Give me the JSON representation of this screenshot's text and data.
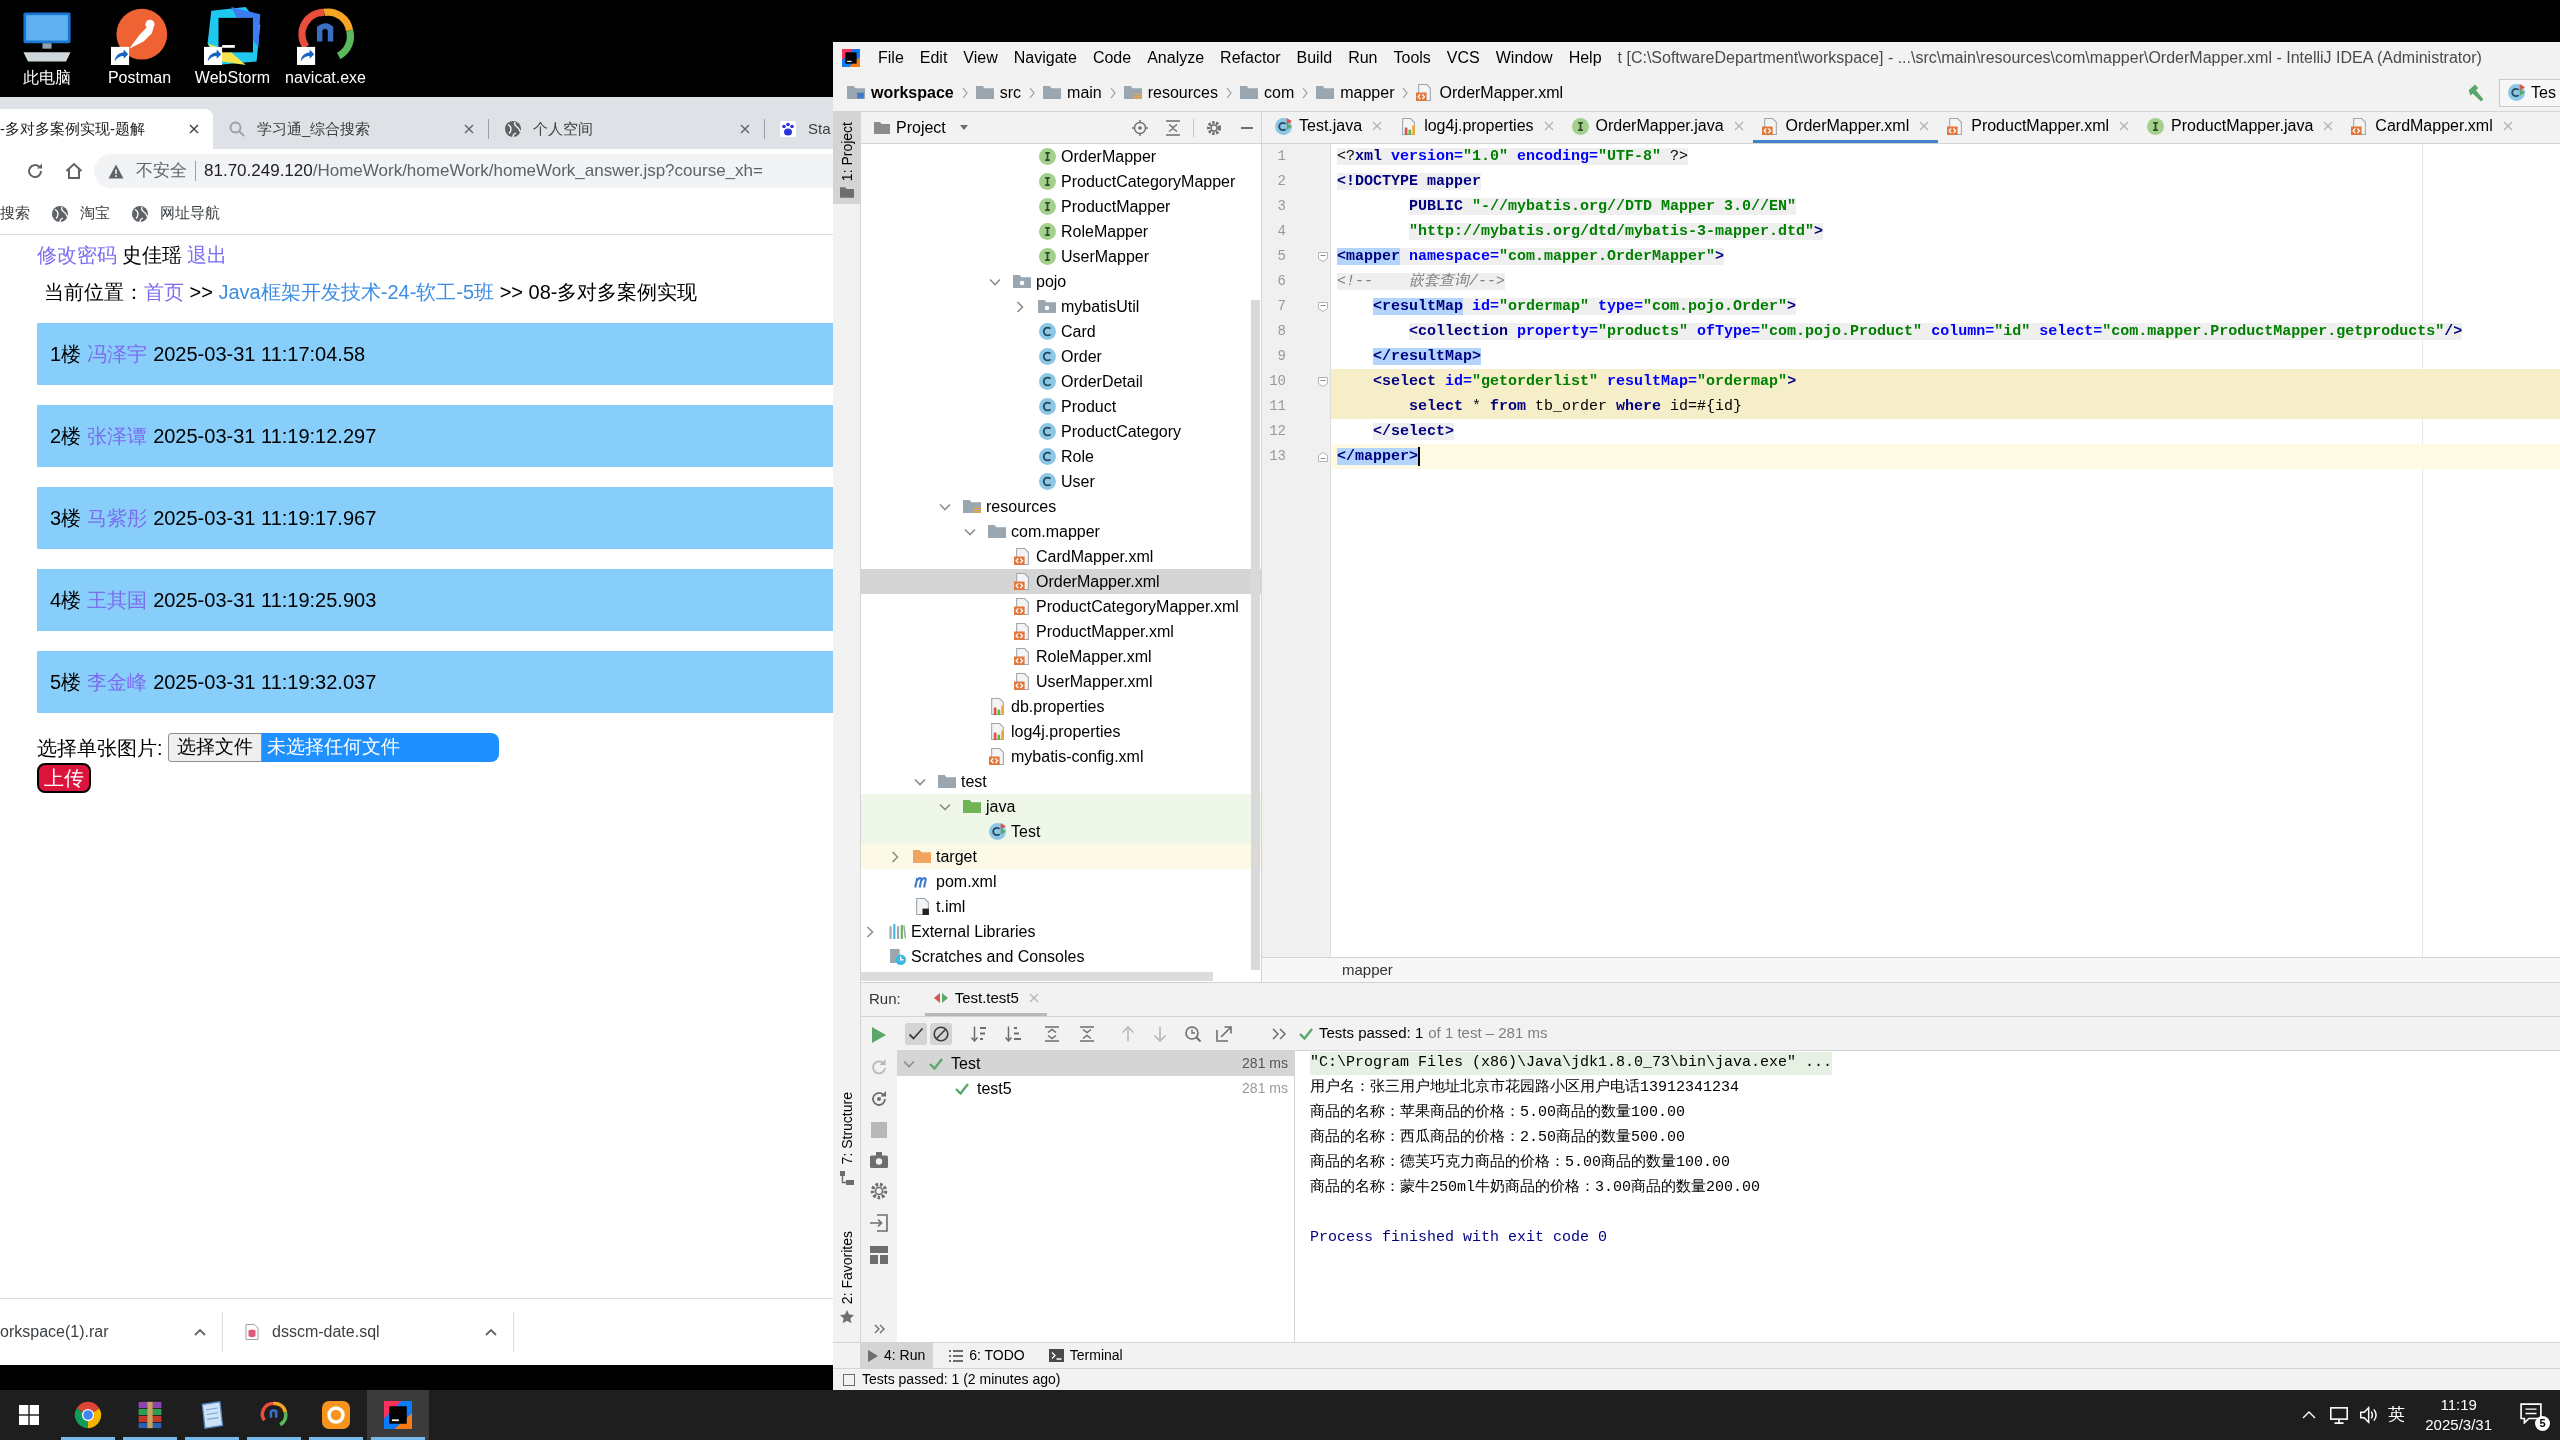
{
  "desktop": {
    "icons": [
      {
        "label": "此电脑",
        "kind": "computer",
        "shortcut": false
      },
      {
        "label": "Postman",
        "kind": "postman",
        "shortcut": true
      },
      {
        "label": "WebStorm",
        "kind": "webstorm",
        "shortcut": true
      },
      {
        "label": "navicat.exe",
        "kind": "navicat",
        "shortcut": true
      }
    ]
  },
  "browser": {
    "tabs": [
      {
        "title": "-多对多案例实现-题解",
        "selected": true
      },
      {
        "title": "学习通_综合搜索",
        "kind": "search",
        "selected": false
      },
      {
        "title": "个人空间",
        "kind": "globe",
        "selected": false
      },
      {
        "title": "Sta",
        "kind": "paw",
        "selected": false
      }
    ],
    "address": {
      "security": "不安全",
      "host": "81.70.249.120",
      "path": "/HomeWork/homeWork/homeWork_answer.jsp?course_xh="
    },
    "bookmarks": [
      {
        "label": "搜索"
      },
      {
        "label": "淘宝",
        "kind": "globe"
      },
      {
        "label": "网址导航",
        "kind": "globe"
      }
    ],
    "page": {
      "user_bar": [
        {
          "text": "修改密码",
          "kind": "visited"
        },
        {
          "text": "史佳瑶",
          "kind": "text"
        },
        {
          "text": "退出",
          "kind": "visited"
        }
      ],
      "location": [
        {
          "text": "当前位置：",
          "kind": "text"
        },
        {
          "text": "首页",
          "kind": "visited"
        },
        {
          "text": ">>",
          "kind": "text"
        },
        {
          "text": "Java框架开发技术-24-软工-5班",
          "kind": "link"
        },
        {
          "text": ">>",
          "kind": "text"
        },
        {
          "text": "08-多对多案例实现",
          "kind": "text"
        }
      ],
      "replies": [
        {
          "floor": "1楼",
          "author": "冯泽宇",
          "time": "2025-03-31 11:17:04.58"
        },
        {
          "floor": "2楼",
          "author": "张泽谭",
          "time": "2025-03-31 11:19:12.297"
        },
        {
          "floor": "3楼",
          "author": "马紫彤",
          "time": "2025-03-31 11:19:17.967"
        },
        {
          "floor": "4楼",
          "author": "王其国",
          "time": "2025-03-31 11:19:25.903"
        },
        {
          "floor": "5楼",
          "author": "李金峰",
          "time": "2025-03-31 11:19:32.037"
        }
      ],
      "upload": {
        "label": "选择单张图片:",
        "button": "选择文件",
        "status": "未选择任何文件",
        "submit": "上传"
      }
    },
    "downloads": [
      {
        "name": "orkspace(1).rar"
      },
      {
        "name": "dsscm-date.sql",
        "kind": "sql"
      }
    ]
  },
  "ide": {
    "menu": [
      "File",
      "Edit",
      "View",
      "Navigate",
      "Code",
      "Analyze",
      "Refactor",
      "Build",
      "Run",
      "Tools",
      "VCS",
      "Window",
      "Help"
    ],
    "title": "t [C:\\SoftwareDepartment\\workspace] - ...\\src\\main\\resources\\com\\mapper\\OrderMapper.xml - IntelliJ IDEA (Administrator)",
    "nav": [
      {
        "label": "workspace",
        "kind": "module"
      },
      {
        "label": "src",
        "kind": "folder"
      },
      {
        "label": "main",
        "kind": "folder"
      },
      {
        "label": "resources",
        "kind": "resources"
      },
      {
        "label": "com",
        "kind": "folder"
      },
      {
        "label": "mapper",
        "kind": "folder"
      },
      {
        "label": "OrderMapper.xml",
        "kind": "xml"
      }
    ],
    "run_config": "Tes",
    "stripe": {
      "top": [
        {
          "label": "1: Project",
          "kind": "folder",
          "selected": true
        }
      ],
      "bottom": [
        {
          "label": "7: Structure",
          "kind": "structure",
          "selected": false
        },
        {
          "label": "2: Favorites",
          "kind": "star",
          "selected": false
        }
      ]
    },
    "project": {
      "title": "Project",
      "tree": [
        {
          "children": [
            {
              "children": [
                {
                  "children": [
                    {
                      "children": [
                        {
                          "children": [
                            {
                              "children": [
                                {
                                  "label": "OrderMapper",
                                  "kind": "interface",
                                  "selected": false
                                },
                                {
                                  "label": "ProductCategoryMapper",
                                  "kind": "interface",
                                  "selected": false
                                },
                                {
                                  "label": "ProductMapper",
                                  "kind": "interface",
                                  "selected": false
                                },
                                {
                                  "label": "RoleMapper",
                                  "kind": "interface",
                                  "selected": false
                                },
                                {
                                  "label": "UserMapper",
                                  "kind": "interface",
                                  "selected": false
                                }
                              ]
                            },
                            {
                              "label": "pojo",
                              "kind": "package",
                              "expanded": true,
                              "selected": false,
                              "children": [
                                {
                                  "label": "mybatisUtil",
                                  "kind": "package",
                                  "expanded": false,
                                  "selected": false
                                },
                                {
                                  "label": "Card",
                                  "kind": "class",
                                  "selected": false
                                },
                                {
                                  "label": "Order",
                                  "kind": "class",
                                  "selected": false
                                },
                                {
                                  "label": "OrderDetail",
                                  "kind": "class",
                                  "selected": false
                                },
                                {
                                  "label": "Product",
                                  "kind": "class",
                                  "selected": false
                                },
                                {
                                  "label": "ProductCategory",
                                  "kind": "class",
                                  "selected": false
                                },
                                {
                                  "label": "Role",
                                  "kind": "class",
                                  "selected": false
                                },
                                {
                                  "label": "User",
                                  "kind": "class",
                                  "selected": false
                                }
                              ]
                            }
                          ]
                        }
                      ]
                    },
                    {
                      "label": "resources",
                      "kind": "resources",
                      "expanded": true,
                      "selected": false,
                      "children": [
                        {
                          "label": "com.mapper",
                          "kind": "folder",
                          "expanded": true,
                          "selected": false,
                          "children": [
                            {
                              "label": "CardMapper.xml",
                              "kind": "xml",
                              "selected": false
                            },
                            {
                              "label": "OrderMapper.xml",
                              "kind": "xml",
                              "selected": true
                            },
                            {
                              "label": "ProductCategoryMapper.xml",
                              "kind": "xml",
                              "selected": false
                            },
                            {
                              "label": "ProductMapper.xml",
                              "kind": "xml",
                              "selected": false
                            },
                            {
                              "label": "RoleMapper.xml",
                              "kind": "xml",
                              "selected": false
                            },
                            {
                              "label": "UserMapper.xml",
                              "kind": "xml",
                              "selected": false
                            }
                          ]
                        },
                        {
                          "label": "db.properties",
                          "kind": "properties",
                          "selected": false
                        },
                        {
                          "label": "log4j.properties",
                          "kind": "properties",
                          "selected": false
                        },
                        {
                          "label": "mybatis-config.xml",
                          "kind": "xml",
                          "selected": false
                        }
                      ]
                    }
                  ]
                },
                {
                  "label": "test",
                  "kind": "folder",
                  "expanded": true,
                  "selected": false,
                  "children": [
                    {
                      "label": "java",
                      "kind": "test-root",
                      "expanded": true,
                      "selected": false,
                      "children": [
                        {
                          "label": "Test",
                          "kind": "test-class",
                          "selected": false
                        }
                      ]
                    }
                  ]
                }
              ]
            },
            {
              "label": "target",
              "kind": "excluded",
              "expanded": false,
              "selected": false
            },
            {
              "label": "pom.xml",
              "kind": "maven",
              "selected": false
            },
            {
              "label": "t.iml",
              "kind": "iml",
              "selected": false
            }
          ]
        },
        {
          "label": "External Libraries",
          "kind": "libraries",
          "expanded": false,
          "selected": false
        },
        {
          "label": "Scratches and Consoles",
          "kind": "scratches",
          "selected": false
        }
      ]
    },
    "editor": {
      "tabs": [
        {
          "label": "Test.java",
          "kind": "test-class",
          "selected": false
        },
        {
          "label": "log4j.properties",
          "kind": "properties",
          "selected": false
        },
        {
          "label": "OrderMapper.java",
          "kind": "interface",
          "selected": false
        },
        {
          "label": "OrderMapper.xml",
          "kind": "xml",
          "selected": true
        },
        {
          "label": "ProductMapper.xml",
          "kind": "xml",
          "selected": false
        },
        {
          "label": "ProductMapper.java",
          "kind": "interface",
          "selected": false
        },
        {
          "label": "CardMapper.xml",
          "kind": "xml",
          "selected": false
        }
      ],
      "lines": [
        {
          "number": "1",
          "kind": "plain",
          "highlighted": false,
          "caret": false,
          "tokens": [
            {
              "text": "<?",
              "kind": "text"
            },
            {
              "text": "xml",
              "kind": "tag"
            },
            {
              "text": " version=",
              "kind": "attr"
            },
            {
              "text": "\"1.0\"",
              "kind": "value"
            },
            {
              "text": " encoding=",
              "kind": "attr"
            },
            {
              "text": "\"UTF-8\"",
              "kind": "value"
            },
            {
              "text": " ?>",
              "kind": "text"
            }
          ]
        },
        {
          "number": "2",
          "kind": "plain",
          "highlighted": false,
          "caret": false,
          "tokens": [
            {
              "text": "<!DOCTYPE",
              "kind": "tag"
            },
            {
              "text": " mapper",
              "kind": "tag"
            }
          ]
        },
        {
          "number": "3",
          "kind": "plain",
          "highlighted": false,
          "caret": false,
          "tokens": [
            {
              "text": "        PUBLIC",
              "kind": "tag"
            },
            {
              "text": " \"-//mybatis.org//DTD Mapper 3.0//EN\"",
              "kind": "value"
            }
          ]
        },
        {
          "number": "4",
          "kind": "plain",
          "highlighted": false,
          "caret": false,
          "tokens": [
            {
              "text": "        \"http://mybatis.org/dtd/mybatis-3-mapper.dtd\"",
              "kind": "value"
            },
            {
              "text": ">",
              "kind": "tag"
            }
          ]
        },
        {
          "number": "5",
          "kind": "open",
          "highlighted": false,
          "caret": false,
          "tokens": [
            {
              "text": "<mapper",
              "kind": "match"
            },
            {
              "text": " namespace=",
              "kind": "attr"
            },
            {
              "text": "\"com.mapper.OrderMapper\"",
              "kind": "value"
            },
            {
              "text": ">",
              "kind": "tag"
            }
          ]
        },
        {
          "number": "6",
          "kind": "plain",
          "highlighted": false,
          "caret": false,
          "tokens": [
            {
              "text": "<!--    嵌套查询/-->",
              "kind": "comment"
            }
          ]
        },
        {
          "number": "7",
          "kind": "open",
          "highlighted": false,
          "caret": false,
          "tokens": [
            {
              "text": "    <resultMap",
              "kind": "match"
            },
            {
              "text": " id=",
              "kind": "attr"
            },
            {
              "text": "\"ordermap\"",
              "kind": "value"
            },
            {
              "text": " type=",
              "kind": "attr"
            },
            {
              "text": "\"com.pojo.Order\"",
              "kind": "value"
            },
            {
              "text": ">",
              "kind": "tag"
            }
          ]
        },
        {
          "number": "8",
          "kind": "plain",
          "highlighted": false,
          "caret": false,
          "tokens": [
            {
              "text": "        <collection",
              "kind": "tag"
            },
            {
              "text": " property=",
              "kind": "attr"
            },
            {
              "text": "\"products\"",
              "kind": "value"
            },
            {
              "text": " ofType=",
              "kind": "attr"
            },
            {
              "text": "\"com.pojo.Product\"",
              "kind": "value"
            },
            {
              "text": " column=",
              "kind": "attr"
            },
            {
              "text": "\"id\"",
              "kind": "value"
            },
            {
              "text": " select=",
              "kind": "attr"
            },
            {
              "text": "\"com.mapper.ProductMapper.getproducts\"",
              "kind": "value"
            },
            {
              "text": "/>",
              "kind": "tag"
            }
          ]
        },
        {
          "number": "9",
          "kind": "plain",
          "highlighted": false,
          "caret": false,
          "tokens": [
            {
              "text": "    </resultMap>",
              "kind": "match"
            }
          ]
        },
        {
          "number": "10",
          "kind": "open",
          "highlighted": true,
          "caret": false,
          "tokens": [
            {
              "text": "    <select",
              "kind": "tag"
            },
            {
              "text": " id=",
              "kind": "attr"
            },
            {
              "text": "\"getorderlist\"",
              "kind": "value"
            },
            {
              "text": " resultMap=",
              "kind": "attr"
            },
            {
              "text": "\"ordermap\"",
              "kind": "value"
            },
            {
              "text": ">",
              "kind": "tag"
            }
          ]
        },
        {
          "number": "11",
          "kind": "plain",
          "highlighted": true,
          "caret": false,
          "tokens": [
            {
              "text": "        select",
              "kind": "keyword"
            },
            {
              "text": " * ",
              "kind": "text"
            },
            {
              "text": "from",
              "kind": "keyword"
            },
            {
              "text": " tb_order ",
              "kind": "text"
            },
            {
              "text": "where",
              "kind": "keyword"
            },
            {
              "text": " id=#{id}",
              "kind": "text"
            }
          ]
        },
        {
          "number": "12",
          "kind": "plain",
          "highlighted": false,
          "caret": false,
          "tokens": [
            {
              "text": "    </select>",
              "kind": "tag"
            }
          ]
        },
        {
          "number": "13",
          "kind": "close",
          "highlighted": false,
          "caret": true,
          "tokens": [
            {
              "text": "</mapper>",
              "kind": "match"
            }
          ]
        }
      ],
      "breadcrumb": "mapper"
    },
    "run": {
      "label": "Run:",
      "tab": "Test.test5",
      "side_tools": [
        {
          "kind": "rerun",
          "disabled": false
        },
        {
          "kind": "rerun-failed",
          "disabled": true
        },
        {
          "kind": "auto-rerun",
          "disabled": false
        },
        {
          "kind": "stop",
          "disabled": true
        },
        {
          "kind": "dump",
          "disabled": false
        },
        {
          "kind": "settings",
          "disabled": false
        },
        {
          "kind": "import",
          "disabled": false
        },
        {
          "kind": "layout",
          "disabled": false
        },
        {
          "kind": "more",
          "disabled": false
        }
      ],
      "tools": [
        {
          "kind": "show-passed",
          "on": true
        },
        {
          "kind": "show-ignored",
          "on": true
        },
        {
          "kind": "sort-alpha",
          "on": false
        },
        {
          "kind": "sort-duration",
          "on": false
        },
        {
          "kind": "expand",
          "on": false
        },
        {
          "kind": "collapse",
          "on": false
        },
        {
          "kind": "previous",
          "on": false
        },
        {
          "kind": "next",
          "on": false
        },
        {
          "kind": "history",
          "on": false
        },
        {
          "kind": "export",
          "on": false
        },
        {
          "kind": "more",
          "on": false
        }
      ],
      "summary": "Tests passed: 1",
      "summary_detail": "of 1 test – 281 ms",
      "tests": [
        {
          "label": "Test",
          "time": "281 ms",
          "kind": "passed",
          "expanded": true,
          "selected": true,
          "children": [
            {
              "label": "test5",
              "time": "281 ms",
              "kind": "passed",
              "selected": false
            }
          ]
        }
      ],
      "console": {
        "command": "\"C:\\Program Files (x86)\\Java\\jdk1.8.0_73\\bin\\java.exe\" ...",
        "lines": [
          "用户名：张三用户地址北京市花园路小区用户电话13912341234",
          "商品的名称：苹果商品的价格：5.00商品的数量100.00",
          "商品的名称：西瓜商品的价格：2.50商品的数量500.00",
          "商品的名称：德芙巧克力商品的价格：5.00商品的数量100.00",
          "商品的名称：蒙牛250ml牛奶商品的价格：3.00商品的数量200.00"
        ],
        "exit": "Process finished with exit code 0"
      }
    },
    "tool_tabs": [
      {
        "label": "4: Run",
        "kind": "run",
        "selected": true
      },
      {
        "label": "6: TODO",
        "kind": "todo",
        "selected": false
      },
      {
        "label": "Terminal",
        "kind": "terminal",
        "selected": false
      }
    ],
    "status": "Tests passed: 1 (2 minutes ago)"
  },
  "taskbar": {
    "apps": [
      {
        "kind": "chrome",
        "running": true,
        "active": false
      },
      {
        "kind": "books",
        "running": true,
        "active": false
      },
      {
        "kind": "notepad",
        "running": true,
        "active": false
      },
      {
        "kind": "navicat",
        "running": true,
        "active": false
      },
      {
        "kind": "ring",
        "running": true,
        "active": false
      },
      {
        "kind": "intellij",
        "running": true,
        "active": true
      }
    ],
    "tray": {
      "ime": "英",
      "time": "11:19",
      "date": "2025/3/31",
      "notifications": "5"
    }
  }
}
